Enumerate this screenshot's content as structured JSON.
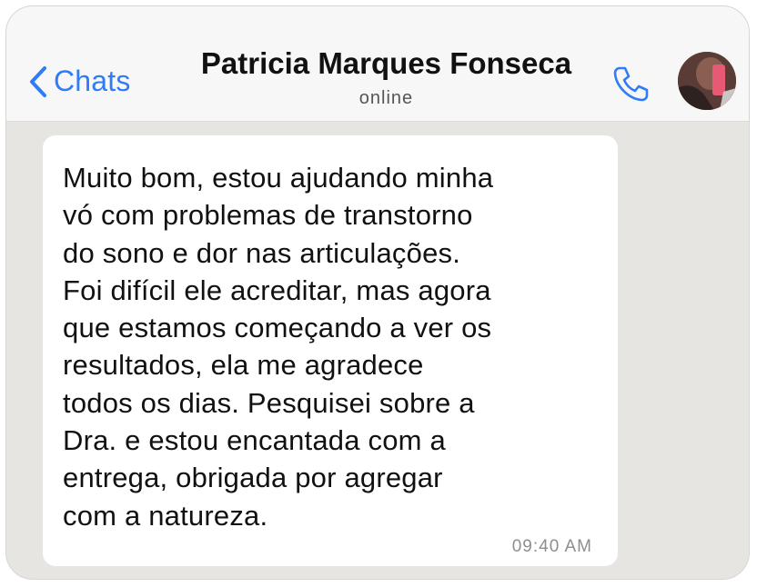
{
  "header": {
    "back_label": "Chats",
    "contact_name": "Patricia Marques Fonseca",
    "status": "online"
  },
  "message": {
    "text": "Muito bom, estou ajudando minha\nvó com problemas de transtorno\ndo sono e dor nas articulações.\nFoi difícil ele acreditar, mas agora\nque estamos começando a ver os\nresultados, ela me agradece\ntodos os dias. Pesquisei sobre a\nDra. e estou encantada com a\nentrega, obrigada por agregar\ncom a natureza.",
    "time": "09:40 AM"
  },
  "icons": {
    "back": "chevron-left-icon",
    "call": "phone-icon",
    "avatar": "contact-avatar"
  },
  "colors": {
    "accent": "#2f7cf6",
    "chat_background": "#e7e5e2",
    "header_background": "#f7f7f7",
    "bubble": "#ffffff"
  }
}
